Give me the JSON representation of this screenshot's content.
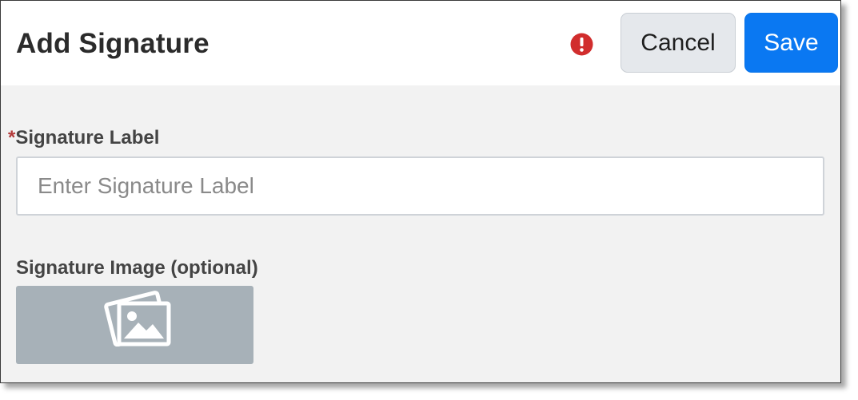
{
  "header": {
    "title": "Add Signature",
    "cancel_label": "Cancel",
    "save_label": "Save",
    "alert_icon": "exclamation-circle-icon"
  },
  "form": {
    "required_marker": "*",
    "signature_label": {
      "label": "Signature Label",
      "value": "",
      "placeholder": "Enter Signature Label",
      "required": true
    },
    "signature_image": {
      "label": "Signature Image (optional)",
      "icon": "image-icon"
    }
  },
  "colors": {
    "save_button": "#0a78f2",
    "cancel_button": "#e5e8ec",
    "alert": "#d12d2d",
    "required": "#b33a3a",
    "image_placeholder": "#a7b1b8"
  }
}
